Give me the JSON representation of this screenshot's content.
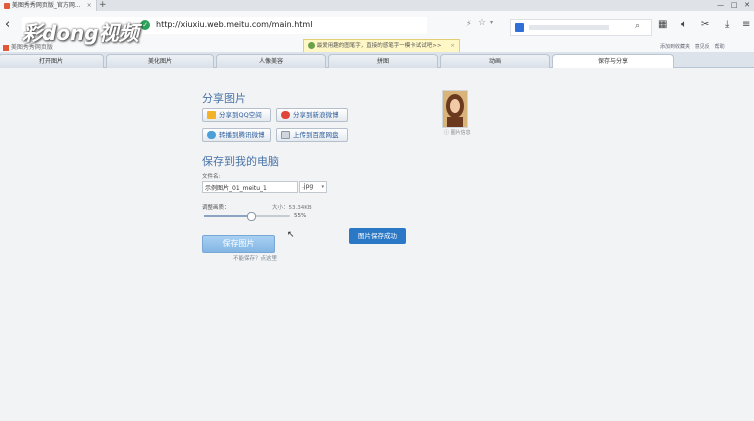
{
  "browser": {
    "tabs": [
      {
        "label": "美图秀秀网页版_官方网...",
        "close": "×"
      }
    ],
    "new_tab_label": "+",
    "url": "http://xiuxiu.web.meitu.com/main.html",
    "window_controls": [
      "—",
      "□",
      "✕"
    ],
    "bookmark": "美图秀秀网页版"
  },
  "watermark": {
    "text": "彩dong视频"
  },
  "notice": {
    "text": "最爱用趣的图笔字，直接的感笔字一模卡试试吧>>",
    "close": "×"
  },
  "top_links": [
    "添加到收藏夹",
    "意见反",
    "帮助"
  ],
  "nav": {
    "tabs": [
      "打开图片",
      "美化图片",
      "人像美容",
      "拼图",
      "动画",
      "保存与分享"
    ],
    "active": "保存与分享"
  },
  "share": {
    "title": "分享图片",
    "buttons": [
      {
        "label": "分享到QQ空间",
        "icon": "qzone-icon"
      },
      {
        "label": "分享到新浪微博",
        "icon": "weibo-icon"
      },
      {
        "label": "转播到腾讯微博",
        "icon": "tencent-weibo-icon"
      },
      {
        "label": "上传到百度网盘",
        "icon": "baidu-pan-icon"
      }
    ]
  },
  "save": {
    "title": "保存到我的电脑",
    "filename_label": "文件名:",
    "filename_value": "示例图片_01_meitu_1",
    "format": ".jpg",
    "quality_label": "调整画质：",
    "size_text": "大小：53.34KB",
    "quality_percent": "55%",
    "quality_value": 0.55,
    "save_button": "保存图片",
    "hint": "不能保存？点这里"
  },
  "preview": {
    "info_label": "图片信息"
  },
  "toast": {
    "text": "图片保存成功"
  },
  "colors": {
    "accent": "#4a74a8",
    "toast": "#2a78c6",
    "save_btn": "#8fbde8"
  }
}
